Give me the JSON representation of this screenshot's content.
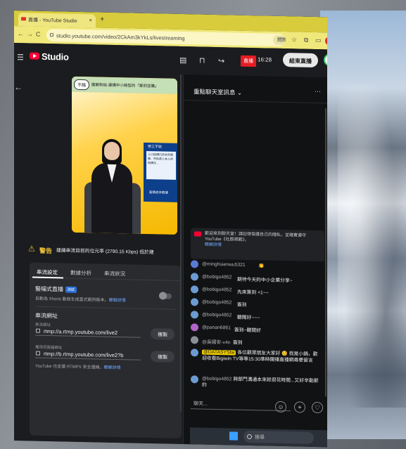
{
  "browser": {
    "tab_title": "直播 - YouTube Studio",
    "tab_close": "×",
    "new_tab": "+",
    "url": "studio.youtube.com/video/2CkAm3kYkLs/livestreaming",
    "google_button": "問問 Google",
    "nav_back": "←",
    "nav_forward": "→",
    "nav_reload": "C"
  },
  "studio": {
    "brand": "Studio",
    "live_badge": "直播",
    "live_time": "16:28",
    "end_stream": "結束直播"
  },
  "video": {
    "badge": "不錯",
    "title_strip": "圖解新給-建構中小微型的「案例並購」",
    "panel_title": "勞工不收",
    "panel_text": "人口結構已改全然報酬、所負責人本人的結構化 ...",
    "panel_bottom": "面積成本數據"
  },
  "warning": {
    "label": "警告",
    "message": "建議串流目前的位元率 (2790.15 Kbps) 低於建"
  },
  "settings": {
    "tabs": [
      "串流設定",
      "數據分析",
      "串流狀況"
    ],
    "dvr_title": "豎幅式直播",
    "beta": "測試",
    "dvr_desc": "自動為 Shorts 動態生成直式範例版本。",
    "learn_more": "瞭解詳情",
    "stream_url_title": "串流網址",
    "stream_url_label": "串流網址",
    "stream_url": "rtmp://a.rtmp.youtube.com/live2",
    "backup_url_label": "備用伺服器網址",
    "backup_url": "rtmp://b.rtmp.youtube.com/live2?b",
    "rtmps_note": "YouTube 也支援 RTMPS 安全連線。",
    "rtmps_more": "瞭解詳情",
    "copy_label": "複製"
  },
  "chat": {
    "title": "重點聊天室訊息",
    "notice": "歡迎來到聊天室！請記得保護自己的隱私，並確實遵守 YouTube《社群規範》。",
    "notice_link": "瞭解詳情",
    "messages": [
      {
        "name": "@minghsienwu5321",
        "text": "👏",
        "color": "#5b7ad6"
      },
      {
        "name": "@bobigo4852",
        "text": "期待今天的中小企業分享~",
        "color": "#6b9bd1"
      },
      {
        "name": "@bobigo4852",
        "text": "先來簽到 +1~~",
        "color": "#6b9bd1"
      },
      {
        "name": "@bobigo4852",
        "text": "簽到",
        "color": "#6b9bd1"
      },
      {
        "name": "@bobigo4852",
        "text": "聽聞好~~~",
        "color": "#6b9bd1"
      },
      {
        "name": "@panan6861",
        "text": "簽到~聽聞好",
        "color": "#b065c9"
      },
      {
        "name": "@吳國安-v4n",
        "text": "簽到",
        "color": "#8a8e96"
      }
    ],
    "big_name": "@DATASYStw",
    "big_text": "各位觀眾朋友大家好 😊 我是小鍋，歡迎收看Bigiwin TV等等15:30準時開播直播網尋要留言",
    "last_name": "@bobigo4852",
    "last_text": "跨部門溝通本來就很花時間...又好辛勤那的",
    "input_placeholder": "聊天..."
  },
  "taskbar": {
    "search_placeholder": "搜尋"
  }
}
